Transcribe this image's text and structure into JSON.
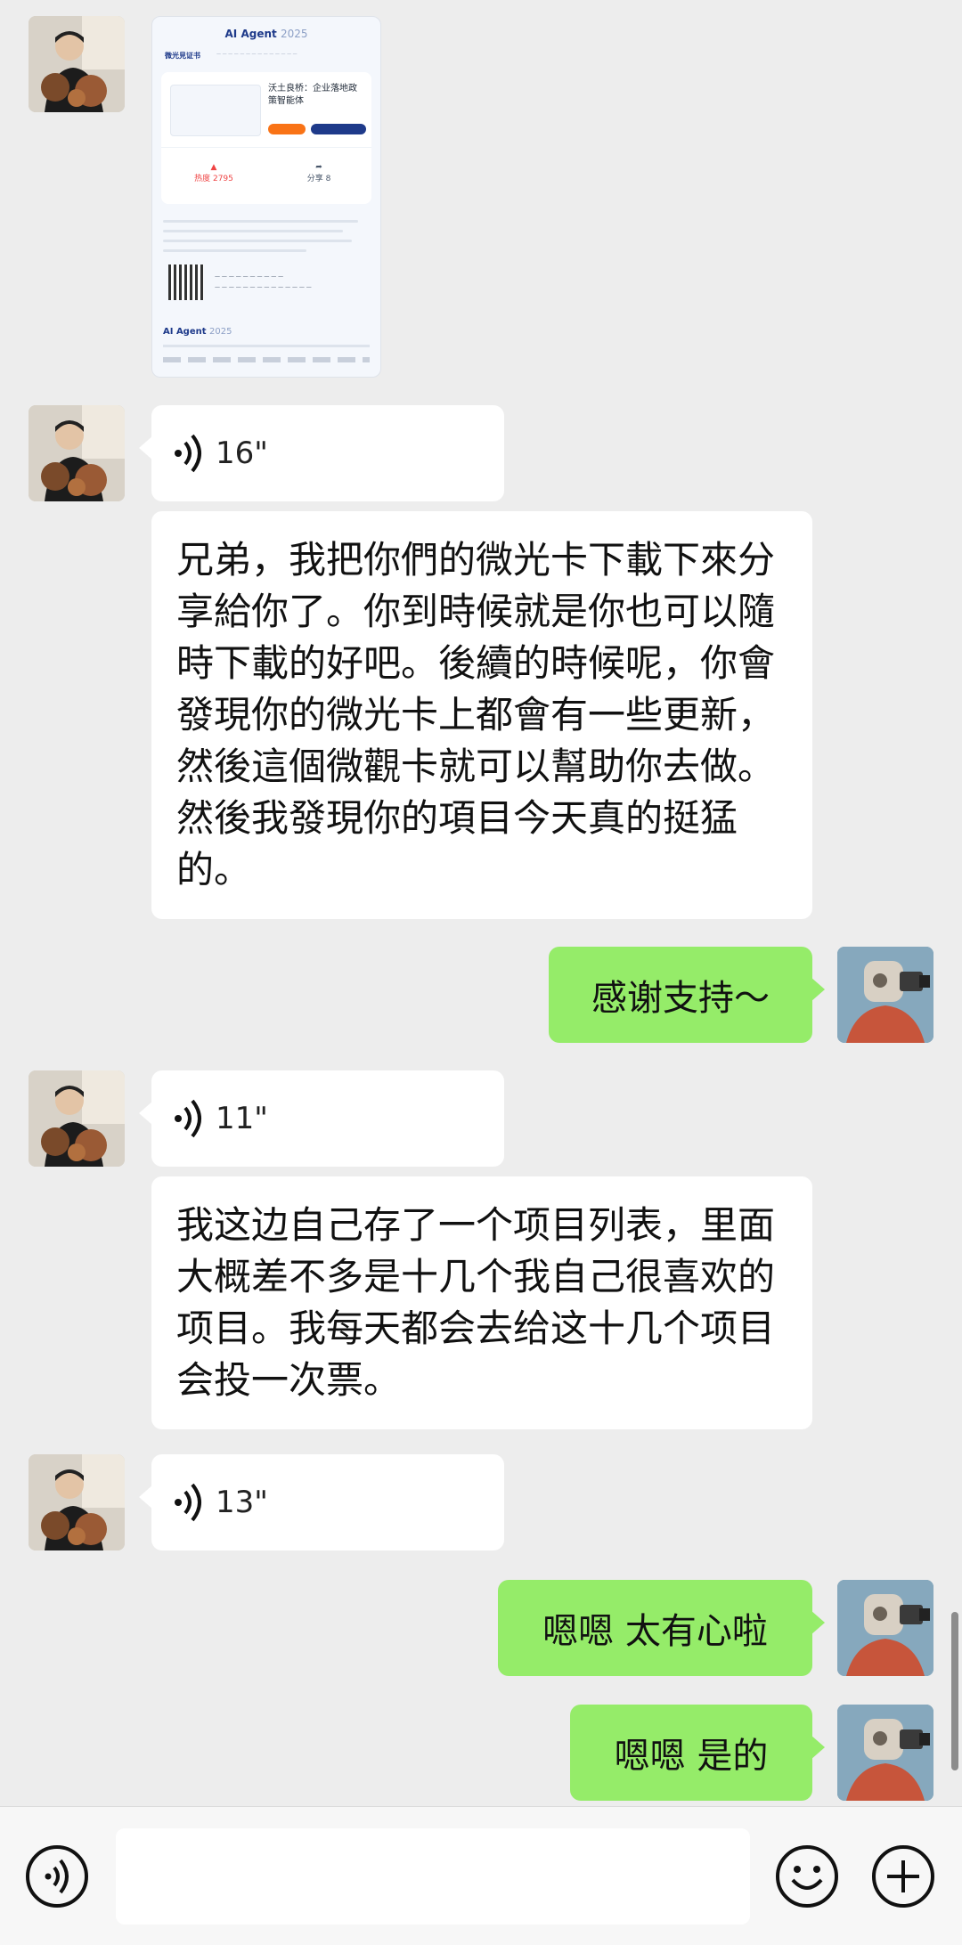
{
  "card": {
    "brand": "AI Agent",
    "brand_year": "2025",
    "cert_title": "微光見证书",
    "project_title": "沃土良桥：企业落地政策智能体",
    "heat": "热度 2795",
    "share": "分享 8"
  },
  "messages": {
    "voice1": "16\"",
    "text1": "兄弟，我把你們的微光卡下載下來分享給你了。你到時候就是你也可以隨時下載的好吧。後續的時候呢，你會發現你的微光卡上都會有一些更新，然後這個微觀卡就可以幫助你去做。然後我發現你的項目今天真的挺猛的。",
    "reply1": "感谢支持～",
    "voice2": "11\"",
    "text2": "我这边自己存了一个项目列表，里面大概差不多是十几个我自己很喜欢的项目。我每天都会去给这十几个项目会投一次票。",
    "voice3": "13\"",
    "reply2": "嗯嗯 太有心啦",
    "reply3": "嗯嗯 是的"
  },
  "input": {
    "voice_icon": "voice-mode-icon",
    "emoji_icon": "emoji-icon",
    "plus_icon": "plus-icon"
  }
}
